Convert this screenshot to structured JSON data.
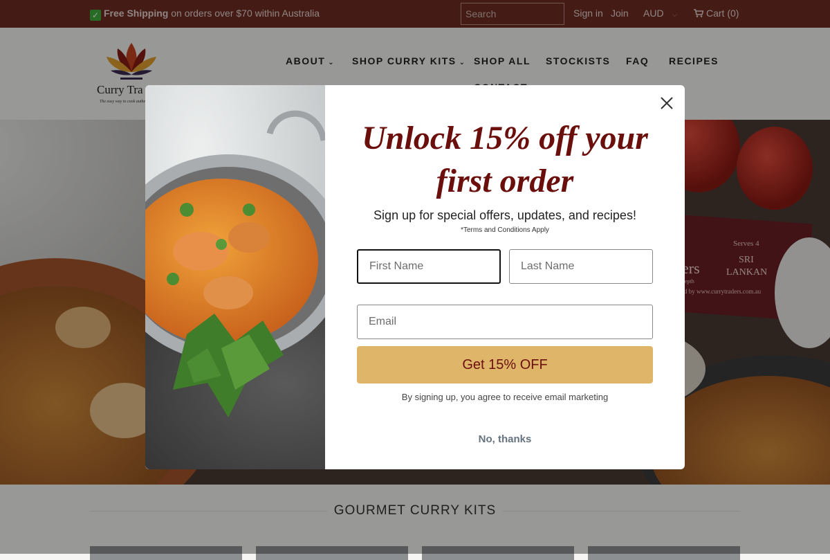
{
  "announcement": {
    "shipping_bold": "Free Shipping",
    "shipping_rest": " on orders over $70 within Australia"
  },
  "topbar": {
    "search_placeholder": "Search",
    "sign_in": "Sign in",
    "join": "Join",
    "currency": "AUD",
    "cart": "Cart (0)"
  },
  "brand": {
    "name": "Curry Tra",
    "tagline": "The easy way to cook authe"
  },
  "nav": {
    "items": [
      {
        "label": "ABOUT"
      },
      {
        "label": "SHOP CURRY KITS"
      },
      {
        "label": "SHOP ALL"
      },
      {
        "label": "STOCKISTS"
      },
      {
        "label": "FAQ"
      },
      {
        "label": "RECIPES"
      },
      {
        "label": "CONTACT"
      }
    ]
  },
  "hero": {
    "pack_text_1": "Serves 4",
    "pack_text_2": "SRI",
    "pack_text_3": "LANKAN",
    "pack_text_4": "ders",
    "pack_text_5": "ed by www.currytraders.com.au",
    "pack_text_6": "depth"
  },
  "section": {
    "title": "GOURMET CURRY KITS"
  },
  "popup": {
    "headline_line1": "Unlock 15% off your",
    "headline_line2": "first order",
    "subhead": "Sign up for special offers, updates, and recipes!",
    "terms": "*Terms and Conditions Apply",
    "first_name_placeholder": "First Name",
    "last_name_placeholder": "Last Name",
    "email_placeholder": "Email",
    "submit_label": "Get 15% OFF",
    "disclaimer": "By signing up, you agree to receive email marketing",
    "no_thanks": "No, thanks"
  },
  "colors": {
    "topbar_bg": "#6f2d23",
    "headline": "#6b0f0c",
    "button_bg": "#dfb569",
    "no_thanks": "#66737f"
  },
  "icons": {
    "check": "check-icon",
    "cart": "cart-icon",
    "close": "close-icon",
    "chevron": "chevron-down-icon"
  }
}
